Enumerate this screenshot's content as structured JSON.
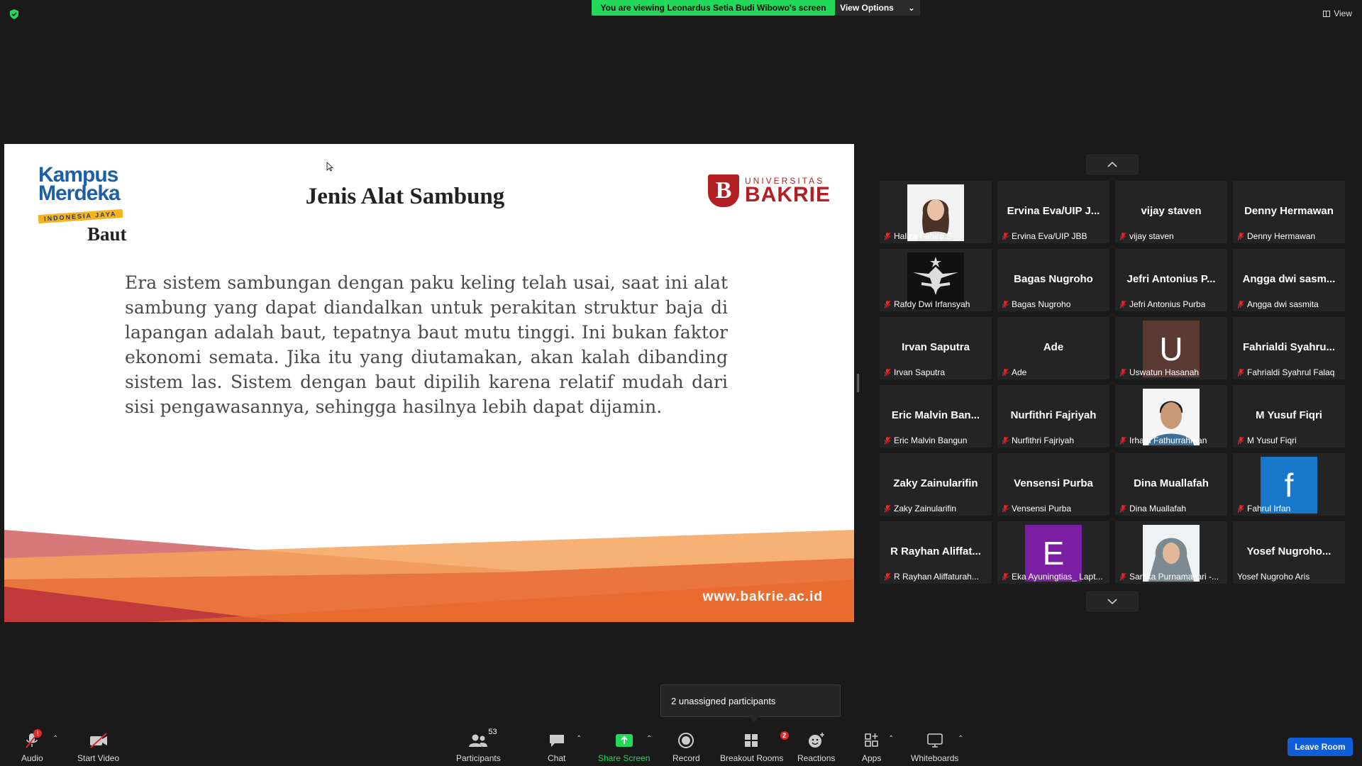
{
  "top": {
    "banner": "You are viewing Leonardus Setia Budi Wibowo's screen",
    "view_options": "View Options",
    "view": "View"
  },
  "slide": {
    "logo_left_line1": "Kampus",
    "logo_left_line2": "Merdeka",
    "logo_left_tag": "INDONESIA JAYA",
    "title": "Jenis Alat Sambung",
    "logo_right_small": "UNIVERSITAS",
    "logo_right_big": "BAKRIE",
    "logo_right_mark": "B",
    "subtitle": "Baut",
    "body": "Era sistem sambungan dengan paku keling telah usai, saat ini alat sambung yang dapat diandalkan untuk perakitan struktur baja di lapangan adalah baut, tepatnya baut mutu tinggi. Ini bukan faktor ekonomi semata. Jika itu yang diutamakan, akan kalah dibanding sistem las. Sistem dengan baut dipilih karena relatif mudah dari sisi pengawasannya, sehingga hasilnya lebih dapat dijamin.",
    "url": "www.bakrie.ac.id"
  },
  "gallery": {
    "tiles": [
      {
        "big": "",
        "label": "Haliza Fahira S",
        "kind": "photo-woman",
        "muted": true
      },
      {
        "big": "Ervina Eva/UIP J...",
        "label": "Ervina Eva/UIP JBB",
        "kind": "name",
        "muted": true
      },
      {
        "big": "vijay staven",
        "label": "vijay staven",
        "kind": "name",
        "muted": true
      },
      {
        "big": "Denny Hermawan",
        "label": "Denny Hermawan",
        "kind": "name",
        "muted": true
      },
      {
        "big": "",
        "label": "Rafdy Dwi Irfansyah",
        "kind": "photo-logo",
        "muted": true
      },
      {
        "big": "Bagas Nugroho",
        "label": "Bagas Nugroho",
        "kind": "name",
        "muted": true
      },
      {
        "big": "Jefri Antonius P...",
        "label": "Jefri Antonius Purba",
        "kind": "name",
        "muted": true
      },
      {
        "big": "Angga dwi sasm...",
        "label": "Angga dwi sasmita",
        "kind": "name",
        "muted": true
      },
      {
        "big": "Irvan Saputra",
        "label": "Irvan Saputra",
        "kind": "name",
        "muted": true
      },
      {
        "big": "Ade",
        "label": "Ade",
        "kind": "name",
        "muted": true
      },
      {
        "big": "",
        "label": "Uswatun Hasanah",
        "kind": "letter",
        "letter": "U",
        "color": "#5b3a34",
        "muted": true
      },
      {
        "big": "Fahrialdi  Syahru...",
        "label": "Fahrialdi Syahrul Falaq",
        "kind": "name",
        "muted": true
      },
      {
        "big": "Eric Malvin Ban...",
        "label": "Eric Malvin Bangun",
        "kind": "name",
        "muted": true
      },
      {
        "big": "Nurfithri Fajriyah",
        "label": "Nurfithri Fajriyah",
        "kind": "name",
        "muted": true
      },
      {
        "big": "",
        "label": "Irham Fathurrahman",
        "kind": "photo-man",
        "muted": true
      },
      {
        "big": "M Yusuf Fiqri",
        "label": "M Yusuf Fiqri",
        "kind": "name",
        "muted": true
      },
      {
        "big": "Zaky Zainularifin",
        "label": "Zaky Zainularifin",
        "kind": "name",
        "muted": true
      },
      {
        "big": "Vensensi Purba",
        "label": "Vensensi Purba",
        "kind": "name",
        "muted": true
      },
      {
        "big": "Dina Muallafah",
        "label": "Dina Muallafah",
        "kind": "name",
        "muted": true
      },
      {
        "big": "",
        "label": "Fahrul Irfan",
        "kind": "letter",
        "letter": "f",
        "color": "#1877c9",
        "muted": true
      },
      {
        "big": "R Rayhan Aliffat...",
        "label": "R Rayhan Aliffaturah...",
        "kind": "name",
        "muted": true
      },
      {
        "big": "",
        "label": "Eka Ayuningtias_ Lapt...",
        "kind": "letter",
        "letter": "E",
        "color": "#7b1fa2",
        "muted": true
      },
      {
        "big": "",
        "label": "Sartika Purnamasari -...",
        "kind": "photo-hijab",
        "muted": true
      },
      {
        "big": "Yosef  Nugroho...",
        "label": "Yosef Nugroho Aris",
        "kind": "name",
        "muted": false
      }
    ]
  },
  "tooltip": "2 unassigned participants",
  "toolbar": {
    "audio": "Audio",
    "audio_badge": "!",
    "start_video": "Start Video",
    "participants": "Participants",
    "participants_count": "53",
    "chat": "Chat",
    "share_screen": "Share Screen",
    "record": "Record",
    "breakout_rooms": "Breakout Rooms",
    "breakout_badge": "2",
    "reactions": "Reactions",
    "apps": "Apps",
    "whiteboards": "Whiteboards",
    "leave_room": "Leave Room"
  },
  "colors": {
    "banner_green": "#23d959",
    "leave_blue": "#0e5fd8",
    "muted_red": "#e02828",
    "brand_red": "#b32024"
  }
}
